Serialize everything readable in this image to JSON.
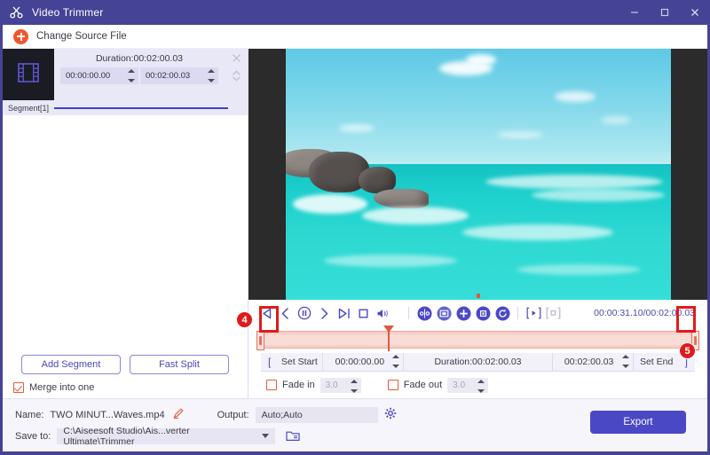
{
  "window": {
    "title": "Video Trimmer",
    "logo_icon": "scissors-icon",
    "minimize_icon": "minimize-icon",
    "maximize_icon": "maximize-icon",
    "close_icon": "close-icon"
  },
  "source_bar": {
    "label": "Change Source File",
    "icon": "plus-circle-icon"
  },
  "segment": {
    "thumb_icon": "film-strip-icon",
    "duration_label": "Duration:00:02:00.03",
    "start_time": "00:00:00.00",
    "end_time": "00:02:00.03",
    "name": "Segment[1]",
    "close_icon": "close-small-icon",
    "reorder_icon": "updown-chevron-icon"
  },
  "left_actions": {
    "add_segment": "Add Segment",
    "fast_split": "Fast Split",
    "merge_label": "Merge into one",
    "merge_checked": true
  },
  "controls": {
    "buttons": [
      {
        "name": "jump-to-start-icon",
        "label": "Previous segment"
      },
      {
        "name": "step-back-icon",
        "label": "Step backward"
      },
      {
        "name": "pause-icon",
        "label": "Pause"
      },
      {
        "name": "step-forward-icon",
        "label": "Step forward"
      },
      {
        "name": "jump-to-end-icon",
        "label": "Next segment"
      },
      {
        "name": "stop-icon",
        "label": "Stop"
      },
      {
        "name": "volume-icon",
        "label": "Volume"
      },
      {
        "name": "split-icon",
        "label": "Split"
      },
      {
        "name": "snapshot-icon",
        "label": "Snapshot"
      },
      {
        "name": "add-icon",
        "label": "Add"
      },
      {
        "name": "delete-icon",
        "label": "Delete"
      },
      {
        "name": "reset-icon",
        "label": "Reset"
      },
      {
        "name": "play-preview-icon",
        "label": "Preview play"
      },
      {
        "name": "stop-preview-icon",
        "label": "Preview stop"
      }
    ],
    "timecode": "00:00:31.10/00:02:00.03"
  },
  "timeline": {
    "left_handle_badge": "4",
    "right_handle_badge": "5",
    "playhead_percent": 29
  },
  "set_row": {
    "bracket_left": "[",
    "set_start": "Set Start",
    "start_value": "00:00:00.00",
    "duration": "Duration:00:02:00.03",
    "end_value": "00:02:00.03",
    "set_end": "Set End",
    "bracket_right": "]"
  },
  "fade": {
    "fade_in_label": "Fade in",
    "fade_in_value": "3.0",
    "fade_in_checked": false,
    "fade_out_label": "Fade out",
    "fade_out_value": "3.0",
    "fade_out_checked": false
  },
  "bottom": {
    "name_label": "Name:",
    "name_value": "TWO MINUT...Waves.mp4",
    "edit_icon": "pencil-icon",
    "output_label": "Output:",
    "output_value": "Auto;Auto",
    "settings_icon": "gear-icon",
    "save_to_label": "Save to:",
    "save_to_value": "C:\\Aiseesoft Studio\\Ais...verter Ultimate\\Trimmer",
    "dropdown_icon": "chevron-down-icon",
    "folder_icon": "folder-icon",
    "export_label": "Export"
  },
  "colors": {
    "brand_purple": "#454396",
    "accent_blue": "#4a48c4",
    "accent_orange": "#f0572d",
    "highlight_red": "#e01b1b",
    "track_pink": "#f6cfc8"
  }
}
